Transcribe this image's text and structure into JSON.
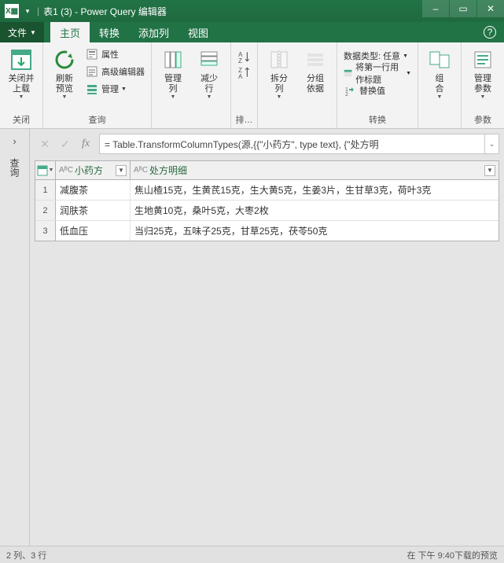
{
  "title": "表1 (3) - Power Query 编辑器",
  "winbtns": {
    "min": "–",
    "max": "▭",
    "close": "✕"
  },
  "file_label": "文件",
  "tabs": [
    "主页",
    "转换",
    "添加列",
    "视图"
  ],
  "active_tab": 0,
  "ribbon": {
    "close_group": {
      "btn": "关闭并\n上载",
      "label": "关闭"
    },
    "query_group": {
      "refresh": "刷新\n预览",
      "props": "属性",
      "adv": "高级编辑器",
      "manage": "管理",
      "label": "查询"
    },
    "col_group": {
      "manage_col": "管理\n列",
      "reduce_row": "减少\n行",
      "label": ""
    },
    "sort_group": {
      "label": "排…"
    },
    "split_group": {
      "split": "拆分\n列",
      "group": "分组\n依据",
      "label": ""
    },
    "transform_group": {
      "dtype_lbl": "数据类型:",
      "dtype_val": "任意",
      "first_row": "将第一行用作标题",
      "replace": "替换值",
      "label": "转换"
    },
    "combine_group": {
      "combine": "组\n合",
      "label": ""
    },
    "param_group": {
      "manage_param": "管理\n参数",
      "label": "参数"
    }
  },
  "sidepanel": "查询",
  "formula": "= Table.TransformColumnTypes(源,{{\"小药方\", type text}, {\"处方明",
  "table": {
    "headers": [
      {
        "type": "AᴮC",
        "name": "小药方"
      },
      {
        "type": "AᴮC",
        "name": "处方明细"
      }
    ],
    "rows": [
      {
        "n": "1",
        "c1": "减腹茶",
        "c2": "焦山楂15克，生黄芪15克，生大黄5克，生姜3片，生甘草3克，荷叶3克"
      },
      {
        "n": "2",
        "c1": "润肤茶",
        "c2": "生地黄10克，桑叶5克，大枣2枚"
      },
      {
        "n": "3",
        "c1": "低血压",
        "c2": "当归25克，五味子25克，甘草25克，茯苓50克"
      }
    ]
  },
  "status_left": "2 列、3 行",
  "status_right": "在 下午 9:40下载的预览"
}
